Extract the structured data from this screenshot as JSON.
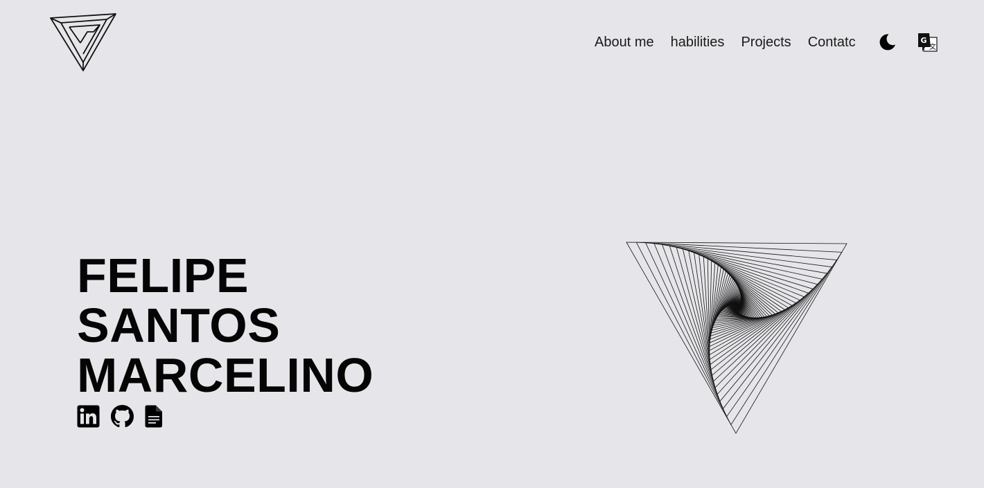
{
  "nav": {
    "items": [
      {
        "label": "About me"
      },
      {
        "label": "habilities"
      },
      {
        "label": "Projects"
      },
      {
        "label": "Contatc"
      }
    ]
  },
  "header": {
    "logo_icon": "impossible-triangle-logo-icon",
    "theme_icon": "moon-icon",
    "language_icon": "translate-icon"
  },
  "hero": {
    "name_lines": [
      "FELIPE",
      "SANTOS",
      "MARCELINO"
    ],
    "socials": [
      {
        "icon": "linkedin-icon"
      },
      {
        "icon": "github-icon"
      },
      {
        "icon": "document-icon"
      }
    ],
    "art_icon": "twisted-triangle-art"
  },
  "colors": {
    "background": "#e6e6ea",
    "text": "#111111",
    "ink": "#000000"
  }
}
